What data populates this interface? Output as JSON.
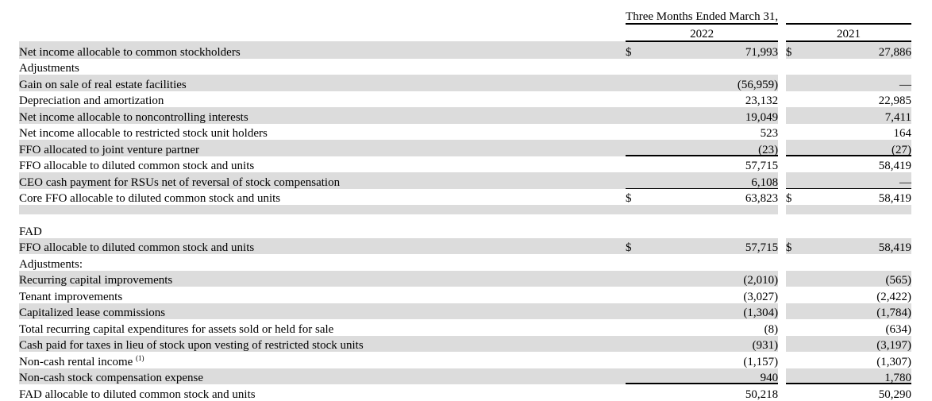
{
  "header": {
    "period_title": "Three Months Ended March 31,",
    "year_current": "2022",
    "year_prior": "2021"
  },
  "currency_symbol": "$",
  "dash": "—",
  "footnote_marker": "(1)",
  "rows": [
    {
      "label": "Net income allocable to common stockholders",
      "v2022": "71,993",
      "v2021": "27,886"
    },
    {
      "label": "Adjustments",
      "v2022": "",
      "v2021": ""
    },
    {
      "label": "Gain on sale of real estate facilities",
      "v2022": "(56,959)",
      "v2021": "—"
    },
    {
      "label": "Depreciation and amortization",
      "v2022": "23,132",
      "v2021": "22,985"
    },
    {
      "label": "Net income allocable to noncontrolling interests",
      "v2022": "19,049",
      "v2021": "7,411"
    },
    {
      "label": "Net income allocable to restricted stock unit holders",
      "v2022": "523",
      "v2021": "164"
    },
    {
      "label": "FFO allocated to joint venture partner",
      "v2022": "(23)",
      "v2021": "(27)"
    },
    {
      "label": "FFO allocable to diluted common stock and units",
      "v2022": "57,715",
      "v2021": "58,419"
    },
    {
      "label": "CEO cash payment for RSUs net of reversal of stock compensation",
      "v2022": "6,108",
      "v2021": "—"
    },
    {
      "label": "Core FFO allocable to diluted common stock and units",
      "v2022": "63,823",
      "v2021": "58,419"
    },
    {
      "label": "FAD",
      "v2022": "",
      "v2021": ""
    },
    {
      "label": "FFO allocable to diluted common stock and units",
      "v2022": "57,715",
      "v2021": "58,419"
    },
    {
      "label": "Adjustments:",
      "v2022": "",
      "v2021": ""
    },
    {
      "label": "Recurring capital improvements",
      "v2022": "(2,010)",
      "v2021": "(565)"
    },
    {
      "label": "Tenant improvements",
      "v2022": "(3,027)",
      "v2021": "(2,422)"
    },
    {
      "label": "Capitalized lease commissions",
      "v2022": "(1,304)",
      "v2021": "(1,784)"
    },
    {
      "label": "Total recurring capital expenditures for assets sold or held for sale",
      "v2022": "(8)",
      "v2021": "(634)"
    },
    {
      "label": "Cash paid for taxes in lieu of stock upon vesting of restricted stock units",
      "v2022": "(931)",
      "v2021": "(3,197)"
    },
    {
      "label": "Non-cash rental income ",
      "v2022": "(1,157)",
      "v2021": "(1,307)"
    },
    {
      "label": "Non-cash stock compensation expense",
      "v2022": "940",
      "v2021": "1,780"
    },
    {
      "label": "FAD allocable to diluted common stock and units",
      "v2022": "50,218",
      "v2021": "50,290"
    }
  ]
}
